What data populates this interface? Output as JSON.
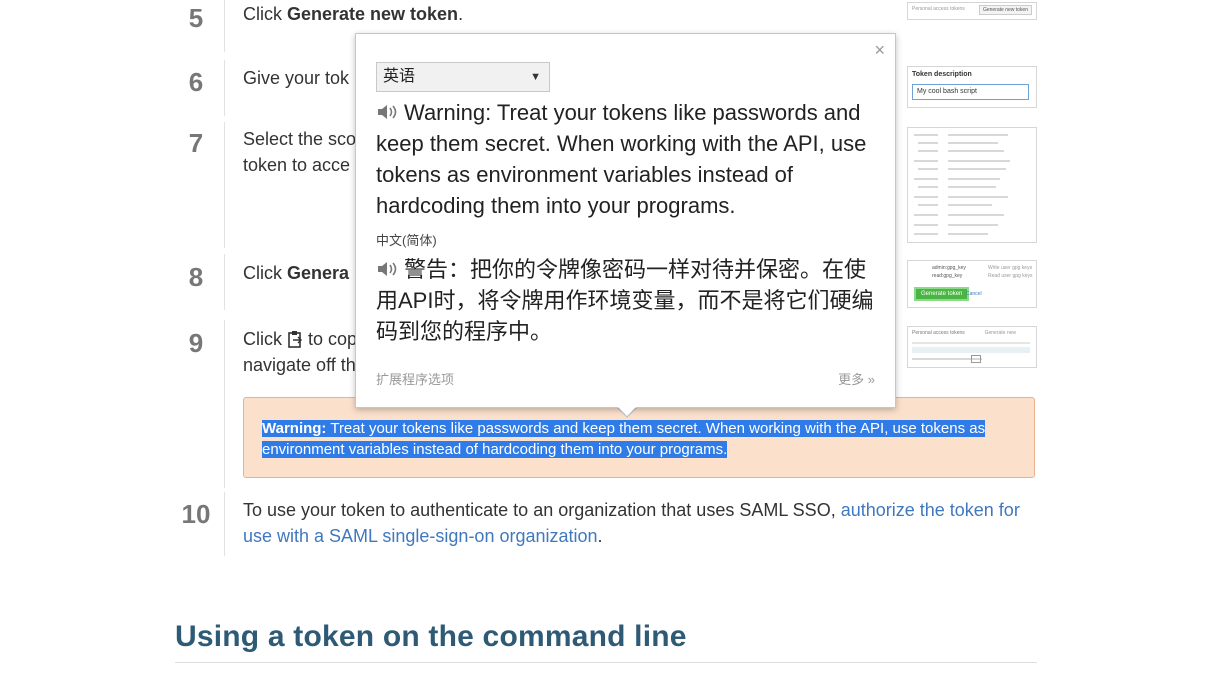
{
  "steps": [
    {
      "num": "5",
      "pre": "Click ",
      "bold": "Generate new token",
      "post": "."
    },
    {
      "num": "6",
      "pre": "Give your tok",
      "bold": "",
      "post": ""
    },
    {
      "num": "7",
      "line1": "Select the sco",
      "line2": "token to acce"
    },
    {
      "num": "8",
      "pre": "Click ",
      "bold": "Genera",
      "post": ""
    },
    {
      "num": "9",
      "line1_pre": "Click ",
      "line1_post": " to cop",
      "line2": "navigate off th"
    },
    {
      "num": "10",
      "pre": "To use your token to authenticate to an organization that uses SAML SSO, ",
      "link": "authorize the token for use with a SAML single-sign-on organization",
      "post": "."
    }
  ],
  "thumbs": {
    "step5_label": "Personal access tokens",
    "step5_button": "Generate new token",
    "step6_title": "Token description",
    "step6_value": "My cool bash script",
    "step8_item1": "admin:gpg_key",
    "step8_item2": "read:gpg_key",
    "step8_desc1": "Write user gpg keys",
    "step8_desc2": "Read user gpg keys",
    "step8_button": "Generate token",
    "step8_cancel": "Cancel",
    "step9_title": "Personal access tokens",
    "step9_action": "Generate new"
  },
  "warning": {
    "label": "Warning:",
    "line1": " Treat your tokens like passwords and keep them secret. When working with the API, use tokens as",
    "line2": "environment variables instead of hardcoding them into your programs."
  },
  "section_title": "Using a token on the command line",
  "popup": {
    "close": "×",
    "source_lang": "英语",
    "source_text": "Warning: Treat your tokens like passwords and keep them secret. When working with the API, use tokens as environment variables instead of hardcoding them into your programs.",
    "target_lang": "中文(简体)",
    "target_text": "警告：把你的令牌像密码一样对待并保密。在使用API时，将令牌用作环境变量，而不是将它们硬编码到您的程序中。",
    "extension_options": "扩展程序选项",
    "more": "更多 »",
    "speaker_icon": "speaker-icon",
    "colors": {
      "selection": "#2f7ce8",
      "warning_bg": "#fbe1cc",
      "link": "#4078c0",
      "heading": "#2e5a75"
    }
  }
}
